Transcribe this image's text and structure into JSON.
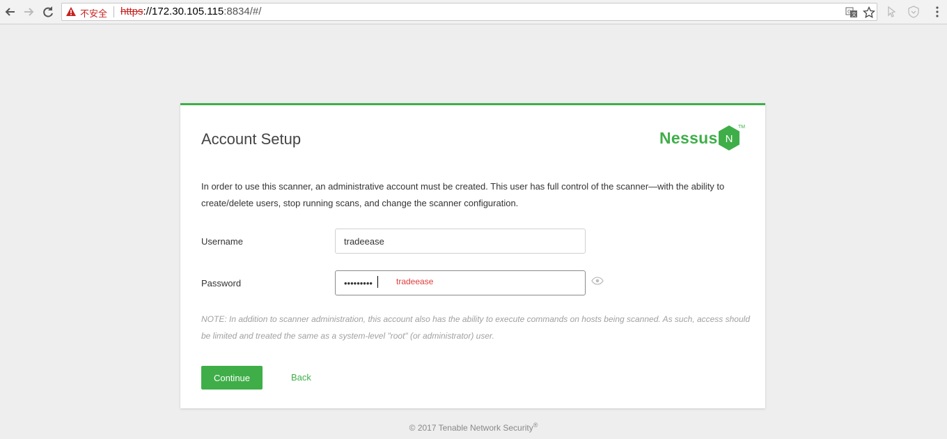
{
  "browser": {
    "security_label": "不安全",
    "url_scheme": "https",
    "url_host": "://172.30.105.115",
    "url_rest": ":8834/#/"
  },
  "icons": {
    "back": "back-arrow-icon",
    "forward": "forward-arrow-icon",
    "reload": "reload-icon",
    "warning": "warning-triangle-icon",
    "translate": "translate-icon",
    "bookmark": "star-icon",
    "eye": "eye-icon"
  },
  "card": {
    "title": "Account Setup",
    "logo_text": "Nessus",
    "logo_letter": "N",
    "logo_tm": "TM",
    "intro": "In order to use this scanner, an administrative account must be created. This user has full control of the scanner—with the ability to create/delete users, stop running scans, and change the scanner configuration.",
    "username_label": "Username",
    "username_value": "tradeease",
    "password_label": "Password",
    "password_value": "tradeease",
    "password_annotation": "tradeease",
    "note": "NOTE: In addition to scanner administration, this account also has the ability to execute commands on hosts being scanned. As such, access should be limited and treated the same as a system-level \"root\" (or administrator) user.",
    "continue_label": "Continue",
    "back_label": "Back"
  },
  "footer": {
    "text": "© 2017 Tenable Network Security",
    "mark": "®"
  },
  "colors": {
    "accent": "#3fae49",
    "insecure": "#c5221f",
    "annotation": "#e03a3a"
  }
}
